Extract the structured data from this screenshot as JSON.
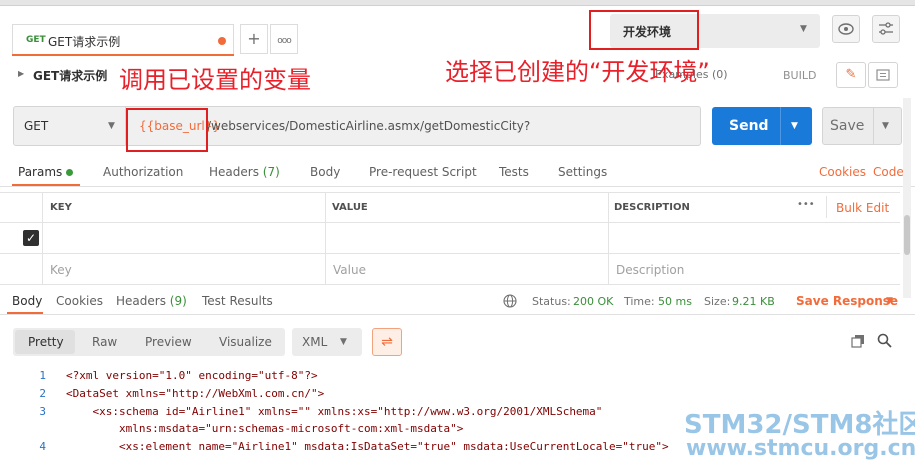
{
  "tabs": [
    {
      "method": "GET",
      "label": "GET请求示例"
    }
  ],
  "tab_actions": {
    "add": "+",
    "more": "ooo"
  },
  "environment": {
    "selected": "开发环境"
  },
  "request": {
    "name": "GET请求示例",
    "examples_label": "Examples (0)",
    "build_label": "BUILD",
    "method": "GET",
    "url_variable": "{{base_url}}",
    "url_path": "/webservices/DomesticAirline.asmx/getDomesticCity?",
    "send_label": "Send",
    "save_label": "Save"
  },
  "annotations": {
    "left": "调用已设置的变量",
    "right": "选择已创建的“开发环境”"
  },
  "request_tabs": [
    {
      "label": "Params"
    },
    {
      "label": "Authorization"
    },
    {
      "label": "Headers",
      "count": "(7)"
    },
    {
      "label": "Body"
    },
    {
      "label": "Pre-request Script"
    },
    {
      "label": "Tests"
    },
    {
      "label": "Settings"
    }
  ],
  "request_links": {
    "cookies": "Cookies",
    "code": "Code"
  },
  "params_table": {
    "headers": {
      "key": "KEY",
      "value": "VALUE",
      "description": "DESCRIPTION"
    },
    "bulk_edit": "Bulk Edit",
    "more": "•••",
    "placeholders": {
      "key": "Key",
      "value": "Value",
      "description": "Description"
    }
  },
  "response_tabs": [
    {
      "label": "Body"
    },
    {
      "label": "Cookies"
    },
    {
      "label": "Headers",
      "count": "(9)"
    },
    {
      "label": "Test Results"
    }
  ],
  "response_status": {
    "status_label": "Status:",
    "status_value": "200 OK",
    "time_label": "Time:",
    "time_value": "50 ms",
    "size_label": "Size:",
    "size_value": "9.21 KB",
    "save_response": "Save Response"
  },
  "format": {
    "options": [
      "Pretty",
      "Raw",
      "Preview",
      "Visualize"
    ],
    "selected": "Pretty",
    "language": "XML"
  },
  "code_lines": [
    {
      "n": "1",
      "text": "<?xml version=\"1.0\" encoding=\"utf-8\"?>"
    },
    {
      "n": "2",
      "text": "<DataSet xmlns=\"http://WebXml.com.cn/\">"
    },
    {
      "n": "3",
      "text": "    <xs:schema id=\"Airline1\" xmlns=\"\" xmlns:xs=\"http://www.w3.org/2001/XMLSchema\""
    },
    {
      "n": "",
      "text": "        xmlns:msdata=\"urn:schemas-microsoft-com:xml-msdata\">"
    },
    {
      "n": "4",
      "text": "        <xs:element name=\"Airline1\" msdata:IsDataSet=\"true\" msdata:UseCurrentLocale=\"true\">"
    }
  ],
  "watermark": {
    "line1": "STM32/STM8社区",
    "line2": "www.stmcu.org.cn"
  },
  "colors": {
    "accent": "#f26b3a",
    "send": "#1a7ad9",
    "annotation": "#e8202a",
    "success": "#3a8f3a"
  }
}
